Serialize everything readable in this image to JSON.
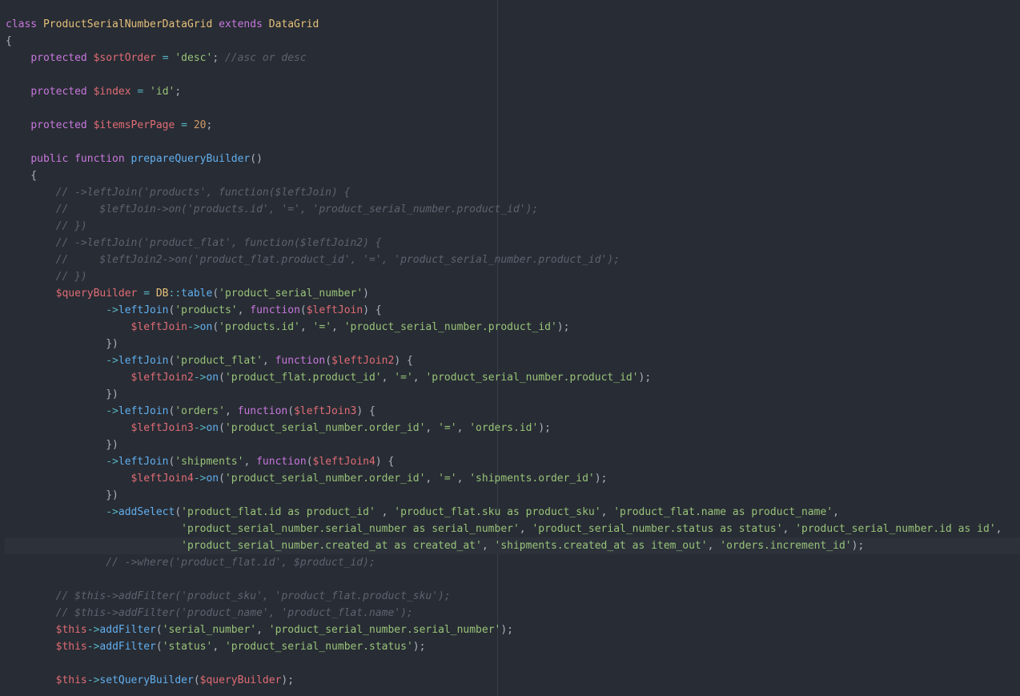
{
  "colors": {
    "background": "#282c34",
    "keyword": "#c678dd",
    "class_name": "#e5c07b",
    "variable": "#e06c75",
    "string": "#98c379",
    "number": "#d19a66",
    "function": "#61afef",
    "operator": "#56b6c2",
    "plain": "#abb2bf",
    "comment": "#5c6370"
  },
  "editor": {
    "cursor": {
      "line": 31,
      "token": 9
    },
    "lines": [
      [
        [
          "keyword",
          "class "
        ],
        [
          "class_name",
          "ProductSerialNumberDataGrid "
        ],
        [
          "keyword",
          "extends "
        ],
        [
          "class_name",
          "DataGrid"
        ]
      ],
      [
        [
          "plain",
          "{"
        ]
      ],
      [
        [
          "plain",
          "    "
        ],
        [
          "keyword",
          "protected "
        ],
        [
          "variable",
          "$sortOrder "
        ],
        [
          "operator",
          "= "
        ],
        [
          "string",
          "'desc'"
        ],
        [
          "plain",
          "; "
        ],
        [
          "comment",
          "//asc or desc"
        ]
      ],
      [],
      [
        [
          "plain",
          "    "
        ],
        [
          "keyword",
          "protected "
        ],
        [
          "variable",
          "$index "
        ],
        [
          "operator",
          "= "
        ],
        [
          "string",
          "'id'"
        ],
        [
          "plain",
          ";"
        ]
      ],
      [],
      [
        [
          "plain",
          "    "
        ],
        [
          "keyword",
          "protected "
        ],
        [
          "variable",
          "$itemsPerPage "
        ],
        [
          "operator",
          "= "
        ],
        [
          "number",
          "20"
        ],
        [
          "plain",
          ";"
        ]
      ],
      [],
      [
        [
          "plain",
          "    "
        ],
        [
          "keyword",
          "public function "
        ],
        [
          "function",
          "prepareQueryBuilder"
        ],
        [
          "plain",
          "()"
        ]
      ],
      [
        [
          "plain",
          "    {"
        ]
      ],
      [
        [
          "plain",
          "        "
        ],
        [
          "comment",
          "// ->leftJoin('products', function($leftJoin) {"
        ]
      ],
      [
        [
          "plain",
          "        "
        ],
        [
          "comment",
          "//     $leftJoin->on('products.id', '=', 'product_serial_number.product_id');"
        ]
      ],
      [
        [
          "plain",
          "        "
        ],
        [
          "comment",
          "// })"
        ]
      ],
      [
        [
          "plain",
          "        "
        ],
        [
          "comment",
          "// ->leftJoin('product_flat', function($leftJoin2) {"
        ]
      ],
      [
        [
          "plain",
          "        "
        ],
        [
          "comment",
          "//     $leftJoin2->on('product_flat.product_id', '=', 'product_serial_number.product_id');"
        ]
      ],
      [
        [
          "plain",
          "        "
        ],
        [
          "comment",
          "// })"
        ]
      ],
      [
        [
          "plain",
          "        "
        ],
        [
          "variable",
          "$queryBuilder "
        ],
        [
          "operator",
          "= "
        ],
        [
          "class_name",
          "DB"
        ],
        [
          "operator",
          "::"
        ],
        [
          "function",
          "table"
        ],
        [
          "plain",
          "("
        ],
        [
          "string",
          "'product_serial_number'"
        ],
        [
          "plain",
          ")"
        ]
      ],
      [
        [
          "plain",
          "                "
        ],
        [
          "operator",
          "->"
        ],
        [
          "function",
          "leftJoin"
        ],
        [
          "plain",
          "("
        ],
        [
          "string",
          "'products'"
        ],
        [
          "plain",
          ", "
        ],
        [
          "keyword",
          "function"
        ],
        [
          "plain",
          "("
        ],
        [
          "variable",
          "$leftJoin"
        ],
        [
          "plain",
          ") {"
        ]
      ],
      [
        [
          "plain",
          "                    "
        ],
        [
          "variable",
          "$leftJoin"
        ],
        [
          "operator",
          "->"
        ],
        [
          "function",
          "on"
        ],
        [
          "plain",
          "("
        ],
        [
          "string",
          "'products.id'"
        ],
        [
          "plain",
          ", "
        ],
        [
          "string",
          "'='"
        ],
        [
          "plain",
          ", "
        ],
        [
          "string",
          "'product_serial_number.product_id'"
        ],
        [
          "plain",
          ");"
        ]
      ],
      [
        [
          "plain",
          "                })"
        ]
      ],
      [
        [
          "plain",
          "                "
        ],
        [
          "operator",
          "->"
        ],
        [
          "function",
          "leftJoin"
        ],
        [
          "plain",
          "("
        ],
        [
          "string",
          "'product_flat'"
        ],
        [
          "plain",
          ", "
        ],
        [
          "keyword",
          "function"
        ],
        [
          "plain",
          "("
        ],
        [
          "variable",
          "$leftJoin2"
        ],
        [
          "plain",
          ") {"
        ]
      ],
      [
        [
          "plain",
          "                    "
        ],
        [
          "variable",
          "$leftJoin2"
        ],
        [
          "operator",
          "->"
        ],
        [
          "function",
          "on"
        ],
        [
          "plain",
          "("
        ],
        [
          "string",
          "'product_flat.product_id'"
        ],
        [
          "plain",
          ", "
        ],
        [
          "string",
          "'='"
        ],
        [
          "plain",
          ", "
        ],
        [
          "string",
          "'product_serial_number.product_id'"
        ],
        [
          "plain",
          ");"
        ]
      ],
      [
        [
          "plain",
          "                })"
        ]
      ],
      [
        [
          "plain",
          "                "
        ],
        [
          "operator",
          "->"
        ],
        [
          "function",
          "leftJoin"
        ],
        [
          "plain",
          "("
        ],
        [
          "string",
          "'orders'"
        ],
        [
          "plain",
          ", "
        ],
        [
          "keyword",
          "function"
        ],
        [
          "plain",
          "("
        ],
        [
          "variable",
          "$leftJoin3"
        ],
        [
          "plain",
          ") {"
        ]
      ],
      [
        [
          "plain",
          "                    "
        ],
        [
          "variable",
          "$leftJoin3"
        ],
        [
          "operator",
          "->"
        ],
        [
          "function",
          "on"
        ],
        [
          "plain",
          "("
        ],
        [
          "string",
          "'product_serial_number.order_id'"
        ],
        [
          "plain",
          ", "
        ],
        [
          "string",
          "'='"
        ],
        [
          "plain",
          ", "
        ],
        [
          "string",
          "'orders.id'"
        ],
        [
          "plain",
          ");"
        ]
      ],
      [
        [
          "plain",
          "                })"
        ]
      ],
      [
        [
          "plain",
          "                "
        ],
        [
          "operator",
          "->"
        ],
        [
          "function",
          "leftJoin"
        ],
        [
          "plain",
          "("
        ],
        [
          "string",
          "'shipments'"
        ],
        [
          "plain",
          ", "
        ],
        [
          "keyword",
          "function"
        ],
        [
          "plain",
          "("
        ],
        [
          "variable",
          "$leftJoin4"
        ],
        [
          "plain",
          ") {"
        ]
      ],
      [
        [
          "plain",
          "                    "
        ],
        [
          "variable",
          "$leftJoin4"
        ],
        [
          "operator",
          "->"
        ],
        [
          "function",
          "on"
        ],
        [
          "plain",
          "("
        ],
        [
          "string",
          "'product_serial_number.order_id'"
        ],
        [
          "plain",
          ", "
        ],
        [
          "string",
          "'='"
        ],
        [
          "plain",
          ", "
        ],
        [
          "string",
          "'shipments.order_id'"
        ],
        [
          "plain",
          ");"
        ]
      ],
      [
        [
          "plain",
          "                })"
        ]
      ],
      [
        [
          "plain",
          "                "
        ],
        [
          "operator",
          "->"
        ],
        [
          "function",
          "addSelect"
        ],
        [
          "plain",
          "("
        ],
        [
          "string",
          "'product_flat.id as product_id' "
        ],
        [
          "plain",
          ", "
        ],
        [
          "string",
          "'product_flat.sku as product_sku'"
        ],
        [
          "plain",
          ", "
        ],
        [
          "string",
          "'product_flat.name as product_name'"
        ],
        [
          "plain",
          ","
        ]
      ],
      [
        [
          "plain",
          "                            "
        ],
        [
          "string",
          "'product_serial_number.serial_number as serial_number'"
        ],
        [
          "plain",
          ", "
        ],
        [
          "string",
          "'product_serial_number.status as status'"
        ],
        [
          "plain",
          ", "
        ],
        [
          "string",
          "'product_serial_number.id as "
        ],
        [
          "string",
          "id'"
        ],
        [
          "plain",
          ","
        ]
      ],
      [
        [
          "plain",
          "                            "
        ],
        [
          "string",
          "'product_serial_number.created_at as created_at'"
        ],
        [
          "plain",
          ", "
        ],
        [
          "string",
          "'shipments.created_at as item_out'"
        ],
        [
          "plain",
          ", "
        ],
        [
          "string",
          "'orders.increment_id'"
        ],
        [
          "plain",
          ");"
        ]
      ],
      [
        [
          "plain",
          "                "
        ],
        [
          "comment",
          "// ->where('product_flat.id', $product_id);"
        ]
      ],
      [],
      [
        [
          "plain",
          "        "
        ],
        [
          "comment",
          "// $this->addFilter('product_sku', 'product_flat.product_sku');"
        ]
      ],
      [
        [
          "plain",
          "        "
        ],
        [
          "comment",
          "// $this->addFilter('product_name', 'product_flat.name');"
        ]
      ],
      [
        [
          "plain",
          "        "
        ],
        [
          "variable",
          "$this"
        ],
        [
          "operator",
          "->"
        ],
        [
          "function",
          "addFilter"
        ],
        [
          "plain",
          "("
        ],
        [
          "string",
          "'serial_number'"
        ],
        [
          "plain",
          ", "
        ],
        [
          "string",
          "'product_serial_number.serial_number'"
        ],
        [
          "plain",
          ");"
        ]
      ],
      [
        [
          "plain",
          "        "
        ],
        [
          "variable",
          "$this"
        ],
        [
          "operator",
          "->"
        ],
        [
          "function",
          "addFilter"
        ],
        [
          "plain",
          "("
        ],
        [
          "string",
          "'status'"
        ],
        [
          "plain",
          ", "
        ],
        [
          "string",
          "'product_serial_number.status'"
        ],
        [
          "plain",
          ");"
        ]
      ],
      [],
      [
        [
          "plain",
          "        "
        ],
        [
          "variable",
          "$this"
        ],
        [
          "operator",
          "->"
        ],
        [
          "function",
          "setQueryBuilder"
        ],
        [
          "plain",
          "("
        ],
        [
          "variable",
          "$queryBuilder"
        ],
        [
          "plain",
          ");"
        ]
      ]
    ]
  }
}
